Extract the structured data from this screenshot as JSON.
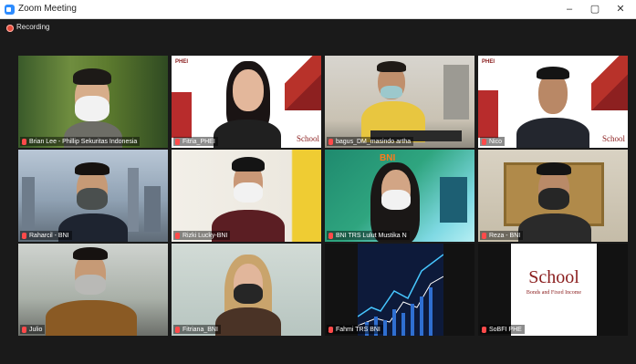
{
  "window": {
    "title": "Zoom Meeting",
    "controls": {
      "minimize": "–",
      "maximize": "▢",
      "close": "✕"
    }
  },
  "recording": {
    "label": "Recording"
  },
  "participants": [
    {
      "name": "Brian Lee - Phillip Sekuritas Indonesia",
      "muted": true
    },
    {
      "name": "Fitria_PHEI",
      "muted": true,
      "active_speaker": true
    },
    {
      "name": "bagus_DM_masindo artha",
      "muted": true
    },
    {
      "name": "Nico",
      "muted": true
    },
    {
      "name": "Raharcil - BNI",
      "muted": true
    },
    {
      "name": "Rizki Lucky-BNI",
      "muted": true
    },
    {
      "name": "BNI TRS Lulut Mustika N",
      "muted": true
    },
    {
      "name": "Reza - BNI",
      "muted": true
    },
    {
      "name": "Julio",
      "muted": true
    },
    {
      "name": "Fitriana_BNI",
      "muted": true
    },
    {
      "name": "Fahmi TRS BNI",
      "muted": true
    },
    {
      "name": "SoBFI PHE",
      "muted": true
    }
  ],
  "branding": {
    "phei": "PHEI",
    "school": "School",
    "school_sub": "Bonds and Fixed Income",
    "bni": "BNI"
  }
}
